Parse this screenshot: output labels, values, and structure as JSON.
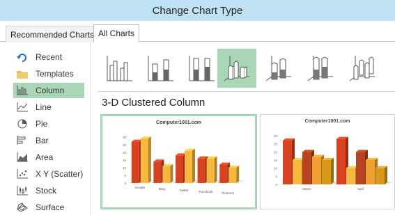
{
  "window": {
    "title": "Change Chart Type"
  },
  "tabs": [
    {
      "label": "Recommended Charts"
    },
    {
      "label": "All Charts"
    }
  ],
  "sidebar": {
    "items": [
      {
        "label": "Recent",
        "icon": "recent-icon"
      },
      {
        "label": "Templates",
        "icon": "folder-icon"
      },
      {
        "label": "Column",
        "icon": "column-chart-icon",
        "selected": true
      },
      {
        "label": "Line",
        "icon": "line-chart-icon"
      },
      {
        "label": "Pie",
        "icon": "pie-chart-icon"
      },
      {
        "label": "Bar",
        "icon": "bar-chart-icon"
      },
      {
        "label": "Area",
        "icon": "area-chart-icon"
      },
      {
        "label": "X Y (Scatter)",
        "icon": "scatter-chart-icon"
      },
      {
        "label": "Stock",
        "icon": "stock-chart-icon"
      },
      {
        "label": "Surface",
        "icon": "surface-chart-icon"
      }
    ]
  },
  "subtypes": [
    {
      "icon": "clustered-column-icon"
    },
    {
      "icon": "stacked-column-icon"
    },
    {
      "icon": "100-stacked-column-icon"
    },
    {
      "icon": "3d-clustered-column-icon",
      "selected": true
    },
    {
      "icon": "3d-stacked-column-icon"
    },
    {
      "icon": "3d-100-stacked-column-icon"
    },
    {
      "icon": "3d-column-icon"
    }
  ],
  "selected_type_title": "3-D Clustered Column",
  "colors": {
    "accent_selected": "#a9d6b6",
    "titlebar": "#bfe2f5",
    "series_dark": "#d9421e",
    "series_light": "#f7b840"
  },
  "previews": [
    {
      "title": "Computer1001.com",
      "chart_data": {
        "type": "bar",
        "categories": [
          "Google",
          "Bing",
          "Twitter",
          "Facebook",
          "Pinterest"
        ],
        "series": [
          {
            "values": [
              27,
              14,
              18,
              16,
              12
            ]
          },
          {
            "values": [
              29,
              11,
              21,
              16,
              10
            ]
          }
        ],
        "ylim": [
          0,
          30
        ],
        "yticks": [
          "30",
          "25",
          "20",
          "15",
          "10",
          "5",
          "0"
        ]
      }
    },
    {
      "title": "Computer1001.com",
      "chart_data": {
        "type": "bar",
        "categories": [
          "March",
          "April"
        ],
        "series": [
          {
            "values": [
              27,
              28
            ]
          },
          {
            "values": [
              15,
              10
            ]
          },
          {
            "values": [
              20,
              20
            ]
          },
          {
            "values": [
              17,
              15
            ]
          },
          {
            "values": [
              15,
              10
            ]
          }
        ],
        "ylim": [
          0,
          30
        ],
        "yticks": [
          "30",
          "25",
          "20",
          "15",
          "10",
          "5",
          "0"
        ]
      }
    }
  ]
}
